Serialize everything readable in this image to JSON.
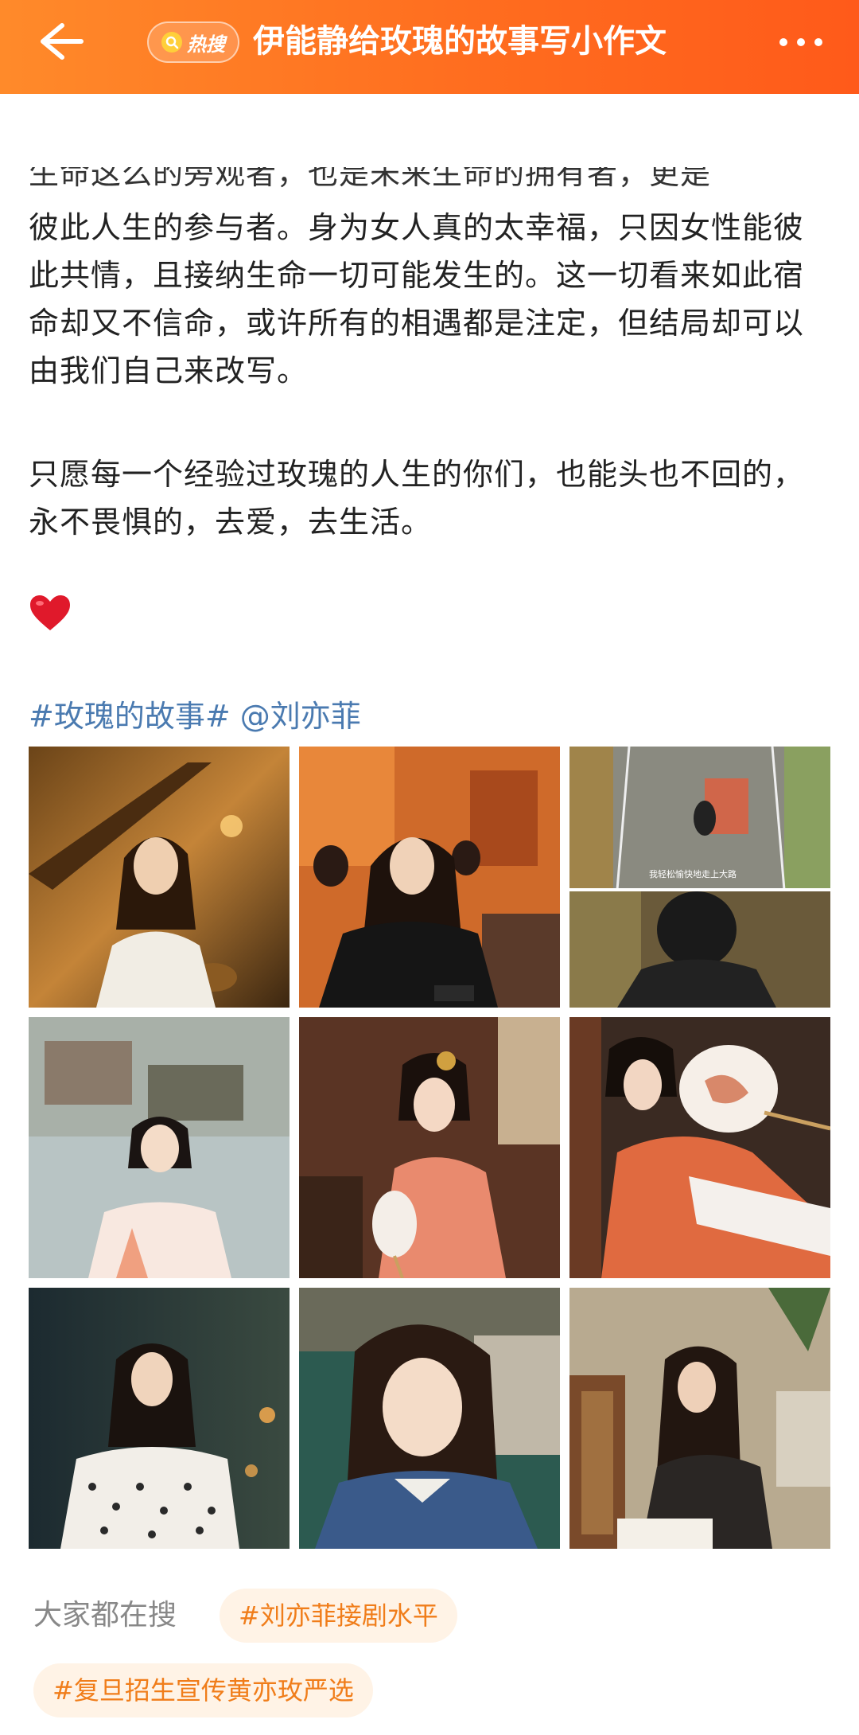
{
  "header": {
    "title": "伊能静给玫瑰的故事写小作文",
    "hot_badge": "热搜",
    "bg_color": "#ff6d1f"
  },
  "post": {
    "cut_line": "生命这么的旁观者，也是未来生命的拥有者，更是",
    "paragraph1": "彼此人生的参与者。身为女人真的太幸福，只因女性能彼此共情，且接纳生命一切可能发生的。这一切看来如此宿命却又不信命，或许所有的相遇都是注定，但结局却可以由我们自己来改写。",
    "paragraph2": "只愿每一个经验过玫瑰的人生的你们，也能头也不回的，永不畏惧的，去爱，去生活。",
    "hashtag": "#玫瑰的故事#",
    "mention": "@刘亦菲"
  },
  "photos": [
    {
      "caption": "",
      "scene": "woman-white-shirt-warm-stairs"
    },
    {
      "caption": "",
      "scene": "woman-black-jacket-restaurant"
    },
    {
      "caption": "我轻松愉快地走上大路",
      "scene": "motorcycle-road-helmet"
    },
    {
      "caption": "",
      "scene": "woman-hanfu-waterside"
    },
    {
      "caption": "",
      "scene": "woman-hanfu-fan-pink"
    },
    {
      "caption": "",
      "scene": "woman-hanfu-fan-orange"
    },
    {
      "caption": "",
      "scene": "woman-polka-dot-dress"
    },
    {
      "caption": "",
      "scene": "woman-denim-shirt"
    },
    {
      "caption": "",
      "scene": "woman-writing-desk"
    }
  ],
  "trending": {
    "label": "大家都在搜",
    "items": [
      "#刘亦菲接剧水平",
      "#复旦招生宣传黄亦玫严选"
    ]
  }
}
